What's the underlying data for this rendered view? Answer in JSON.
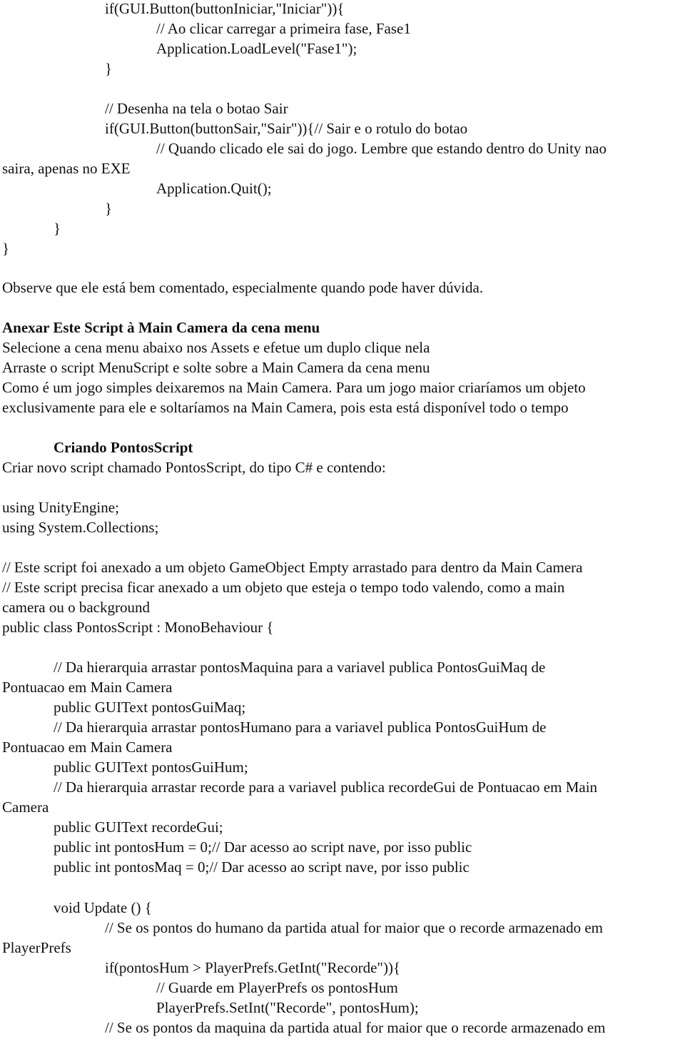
{
  "document": {
    "lines": [
      {
        "text": "if(GUI.Button(buttonIniciar,\"Iniciar\")){"
      },
      {
        "text": "// Ao clicar carregar a primeira fase, Fase1"
      },
      {
        "text": "Application.LoadLevel(\"Fase1\");"
      },
      {
        "text": "}"
      },
      {
        "text": "// Desenha na tela o botao Sair"
      },
      {
        "text": "if(GUI.Button(buttonSair,\"Sair\")){// Sair e o rotulo do botao"
      },
      {
        "text": "// Quando clicado ele sai do jogo. Lembre que estando dentro do Unity nao"
      },
      {
        "text": "saira, apenas no EXE"
      },
      {
        "text": "Application.Quit();"
      },
      {
        "text": "}"
      },
      {
        "text": "}"
      },
      {
        "text": "}"
      },
      {
        "text": "Observe que ele está bem comentado, especialmente quando pode haver dúvida."
      },
      {
        "text": "Anexar Este Script à Main Camera da cena menu"
      },
      {
        "text": "Selecione a cena menu abaixo nos Assets e efetue um duplo clique nela"
      },
      {
        "text": "Arraste o script MenuScript e solte sobre a Main Camera da cena menu"
      },
      {
        "text": "Como é um jogo simples deixaremos na Main Camera. Para um jogo maior criaríamos um objeto"
      },
      {
        "text": "exclusivamente para ele e soltaríamos na Main Camera, pois esta está disponível todo o tempo"
      },
      {
        "text": "Criando PontosScript"
      },
      {
        "text": "Criar novo script chamado PontosScript, do tipo C# e contendo:"
      },
      {
        "text": "using UnityEngine;"
      },
      {
        "text": "using System.Collections;"
      },
      {
        "text": "// Este script foi anexado a um objeto GameObject Empty arrastado para dentro da Main Camera"
      },
      {
        "text": "// Este script precisa ficar anexado a um objeto que esteja o tempo todo valendo, como a main"
      },
      {
        "text": "camera ou o background"
      },
      {
        "text": "public class PontosScript : MonoBehaviour {"
      },
      {
        "text": "// Da hierarquia arrastar pontosMaquina para a variavel publica PontosGuiMaq de"
      },
      {
        "text": "Pontuacao em Main Camera"
      },
      {
        "text": "public GUIText pontosGuiMaq;"
      },
      {
        "text": "// Da hierarquia arrastar pontosHumano para a variavel publica PontosGuiHum de"
      },
      {
        "text": "Pontuacao em Main Camera"
      },
      {
        "text": "public GUIText pontosGuiHum;"
      },
      {
        "text": "// Da hierarquia arrastar recorde para a variavel publica recordeGui de Pontuacao em Main"
      },
      {
        "text": "Camera"
      },
      {
        "text": "public GUIText recordeGui;"
      },
      {
        "text": "public int pontosHum = 0;// Dar acesso ao script nave, por isso public"
      },
      {
        "text": "public int pontosMaq = 0;// Dar acesso ao script nave, por isso public"
      },
      {
        "text": "void Update () {"
      },
      {
        "text": "// Se os pontos do humano da partida atual for maior que o recorde armazenado em"
      },
      {
        "text": "PlayerPrefs"
      },
      {
        "text": "if(pontosHum > PlayerPrefs.GetInt(\"Recorde\")){"
      },
      {
        "text": "// Guarde em PlayerPrefs os pontosHum"
      },
      {
        "text": "PlayerPrefs.SetInt(\"Recorde\", pontosHum);"
      },
      {
        "text": "// Se os pontos da maquina da partida atual for maior que o recorde armazenado em"
      }
    ]
  }
}
